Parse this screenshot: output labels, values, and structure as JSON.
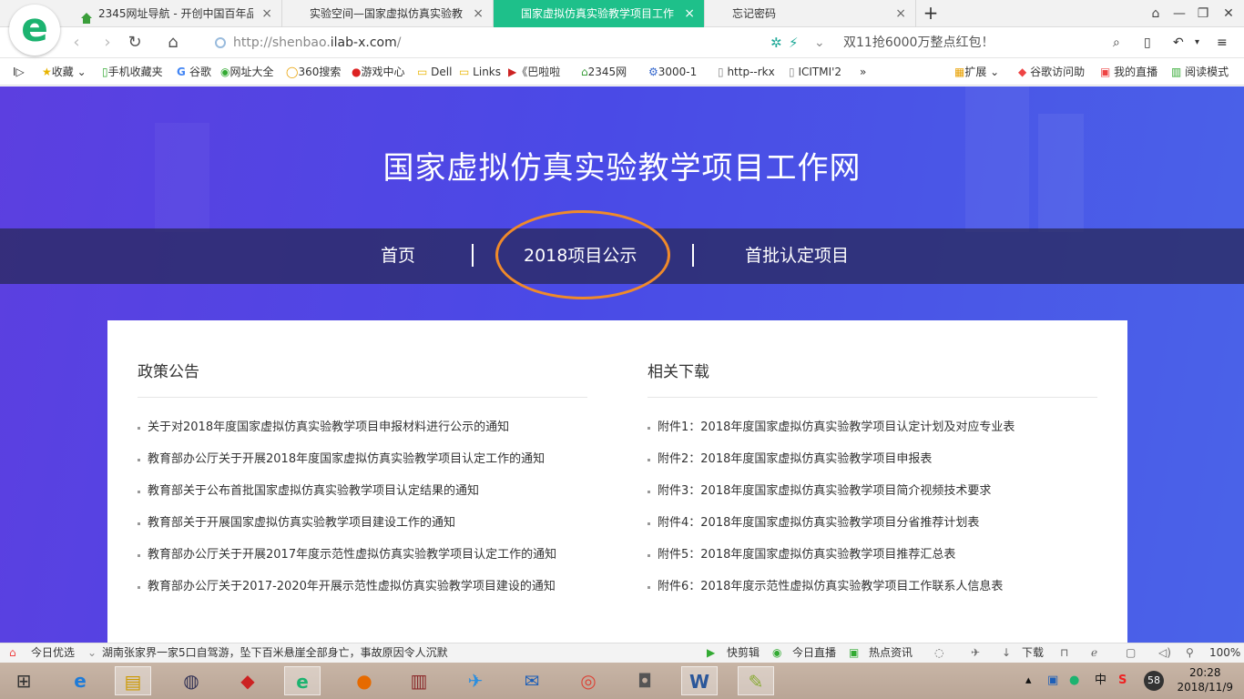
{
  "browser": {
    "tabs": [
      {
        "label": "2345网址导航 - 开创中国百年品",
        "close": "×",
        "active": false
      },
      {
        "label": "实验空间—国家虚拟仿真实验教",
        "close": "×",
        "active": false
      },
      {
        "label": "国家虚拟仿真实验教学项目工作",
        "close": "×",
        "active": true
      },
      {
        "label": "忘记密码",
        "close": "×",
        "active": false
      }
    ],
    "new_tab": "+",
    "address": {
      "scheme": "http://shenbao.",
      "host": "ilab-x.com",
      "path": "/"
    },
    "promo": "双11抢6000万整点红包！",
    "bookmarks": [
      "收藏",
      "手机收藏夹",
      "谷歌",
      "网址大全",
      "360搜索",
      "游戏中心",
      "Dell",
      "Links",
      "《巴啦啦",
      "2345网",
      "3000-1",
      "http--rkx",
      "ICITMI'2"
    ],
    "bookmarks_right": [
      "扩展",
      "谷歌访问助",
      "我的直播",
      "阅读模式"
    ],
    "more": "»",
    "sidebar_toggle": "I▷"
  },
  "page": {
    "site_title": "国家虚拟仿真实验教学项目工作网",
    "menu": [
      "首页",
      "2018项目公示",
      "首批认定项目"
    ],
    "left_title": "政策公告",
    "left_items": [
      "关于对2018年度国家虚拟仿真实验教学项目申报材料进行公示的通知",
      "教育部办公厅关于开展2018年度国家虚拟仿真实验教学项目认定工作的通知",
      "教育部关于公布首批国家虚拟仿真实验教学项目认定结果的通知",
      "教育部关于开展国家虚拟仿真实验教学项目建设工作的通知",
      "教育部办公厅关于开展2017年度示范性虚拟仿真实验教学项目认定工作的通知",
      "教育部办公厅关于2017-2020年开展示范性虚拟仿真实验教学项目建设的通知"
    ],
    "right_title": "相关下载",
    "right_items": [
      "附件1：2018年度国家虚拟仿真实验教学项目认定计划及对应专业表",
      "附件2：2018年度国家虚拟仿真实验教学项目申报表",
      "附件3：2018年度国家虚拟仿真实验教学项目简介视频技术要求",
      "附件4：2018年度国家虚拟仿真实验教学项目分省推荐计划表",
      "附件5：2018年度国家虚拟仿真实验教学项目推荐汇总表",
      "附件6：2018年度示范性虚拟仿真实验教学项目工作联系人信息表"
    ]
  },
  "statusbar": {
    "today": "今日优选",
    "news": "湖南张家界一家5口自驾游，坠下百米悬崖全部身亡，事故原因令人沉默",
    "kuaijian": "快剪辑",
    "live": "今日直播",
    "hot": "热点资讯",
    "download": "下载",
    "zoom": "100%"
  },
  "taskbar": {
    "time": "20:28",
    "date": "2018/11/9",
    "ime": "中",
    "badge": "58"
  },
  "colors": {
    "accent": "#1ec08a",
    "annotation": "#f08a2a"
  }
}
